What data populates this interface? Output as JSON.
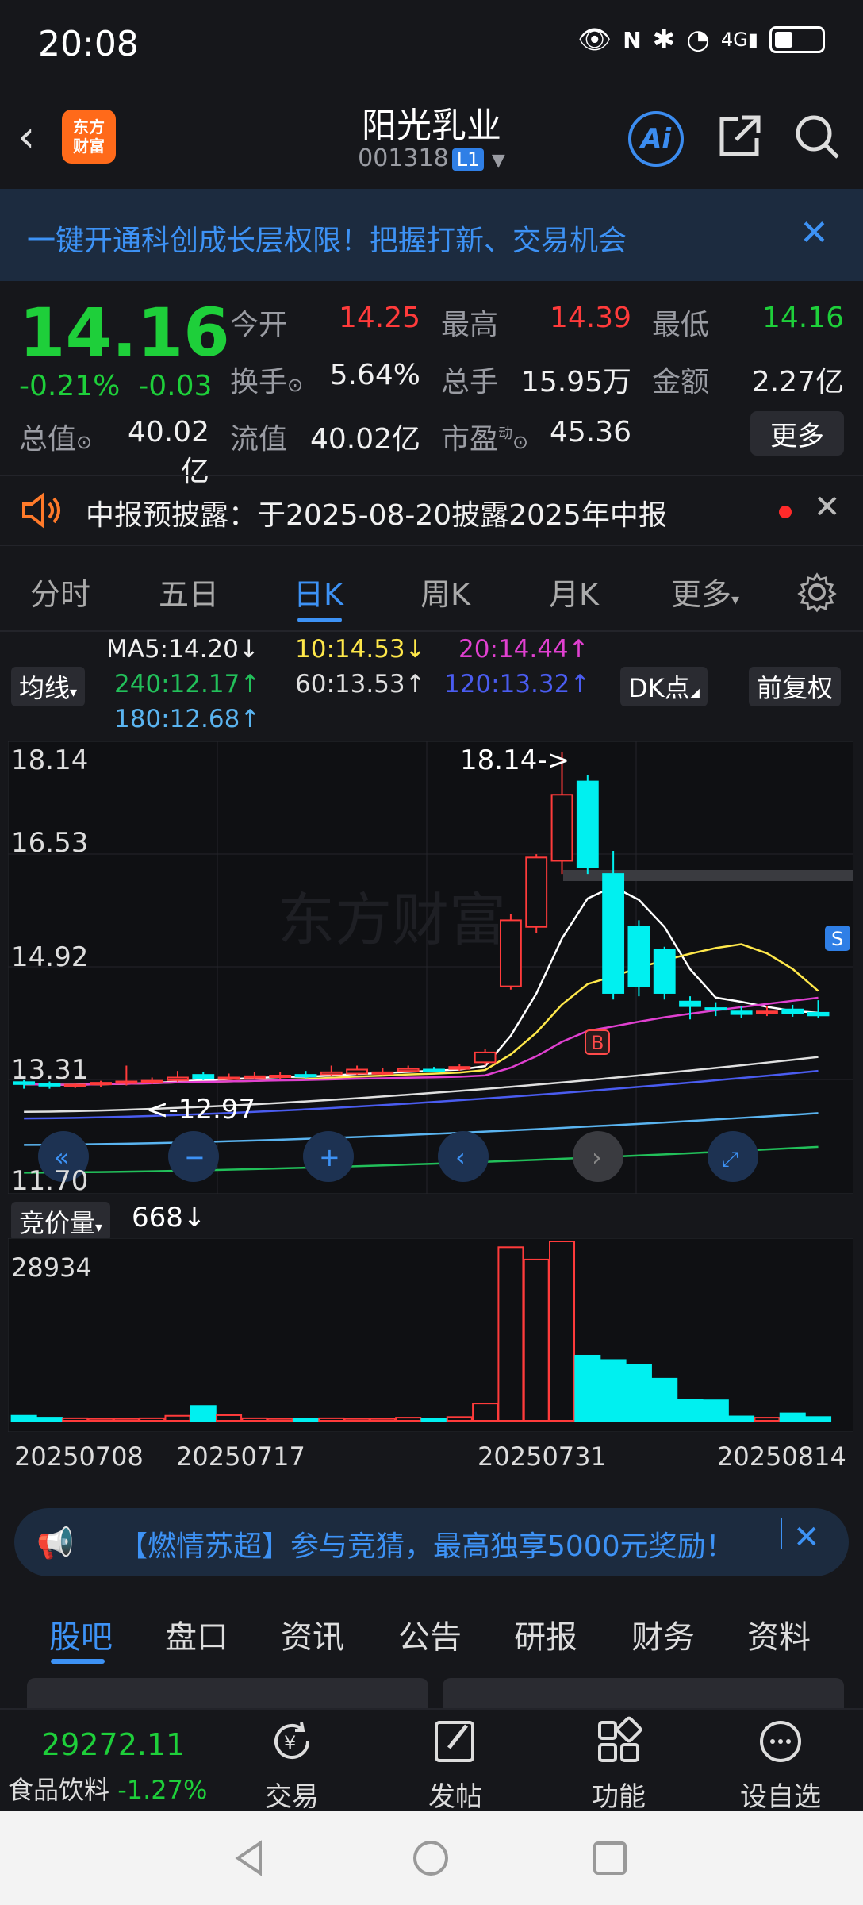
{
  "status": {
    "time": "20:08",
    "network": "4G"
  },
  "header": {
    "logo_line1": "东方",
    "logo_line2": "财富",
    "name": "阳光乳业",
    "code": "001318",
    "level": "L1"
  },
  "promo": {
    "text": "一键开通科创成长层权限！把握打新、交易机会"
  },
  "quote": {
    "price": "14.16",
    "change_pct": "-0.21%",
    "change_abs": "-0.03",
    "open_label": "今开",
    "open": "14.25",
    "high_label": "最高",
    "high": "14.39",
    "low_label": "最低",
    "low": "14.16",
    "turnover_label": "换手",
    "turnover": "5.64%",
    "volume_label": "总手",
    "volume": "15.95万",
    "amount_label": "金额",
    "amount": "2.27亿",
    "mktcap_label": "总值",
    "mktcap": "40.02亿",
    "float_label": "流值",
    "float": "40.02亿",
    "pe_label": "市盈",
    "pe_sup": "动",
    "pe": "45.36",
    "more": "更多"
  },
  "notice": {
    "text": "中报预披露：于2025-08-20披露2025年中报"
  },
  "period_tabs": [
    "分时",
    "五日",
    "日K",
    "周K",
    "月K",
    "更多"
  ],
  "ma_legend": {
    "ma5": "MA5:14.20↓",
    "ma10": "10:14.53↓",
    "ma20": "20:14.44↑",
    "ma240": "240:12.17↑",
    "ma60": "60:13.53↑",
    "ma120": "120:13.32↑",
    "ma180": "180:12.68↑",
    "indicator": "均线",
    "dk": "DK点",
    "adjust": "前复权"
  },
  "chart_labels": {
    "y_top": "18.14",
    "y2": "16.53",
    "y3": "14.92",
    "y4": "13.31",
    "y_bottom": "11.70",
    "high_mark": "18.14->",
    "low_mark": "<-12.97",
    "buy": "B",
    "sell": "S",
    "vol_label": "竞价量",
    "vol_value": "668↓",
    "vol_max": "28934"
  },
  "x_dates": [
    "20250708",
    "20250717",
    "20250731",
    "20250814"
  ],
  "chart_data": {
    "type": "candlestick",
    "open": [
      13.15,
      13.12,
      13.1,
      13.12,
      13.14,
      13.15,
      13.18,
      13.26,
      13.2,
      13.22,
      13.24,
      13.26,
      13.27,
      13.28,
      13.3,
      13.32,
      13.34,
      13.35,
      13.45,
      14.6,
      15.5,
      16.5,
      17.7,
      16.3,
      15.5,
      15.15,
      14.37,
      14.27,
      14.22,
      14.2,
      14.25,
      14.2
    ],
    "close": [
      13.12,
      13.1,
      13.11,
      13.14,
      13.16,
      13.17,
      13.22,
      13.21,
      13.22,
      13.24,
      13.25,
      13.24,
      13.3,
      13.34,
      13.3,
      13.35,
      13.33,
      13.38,
      13.6,
      15.6,
      16.55,
      17.5,
      16.4,
      14.5,
      14.6,
      14.5,
      14.3,
      14.25,
      14.18,
      14.22,
      14.19,
      14.16
    ],
    "high": [
      13.18,
      13.16,
      13.14,
      13.17,
      13.4,
      13.22,
      13.32,
      13.3,
      13.28,
      13.3,
      13.3,
      13.32,
      13.4,
      13.4,
      13.36,
      13.4,
      13.38,
      13.42,
      13.65,
      15.7,
      16.6,
      18.14,
      17.8,
      16.65,
      15.6,
      15.2,
      14.45,
      14.36,
      14.3,
      14.3,
      14.32,
      14.39
    ],
    "low": [
      13.05,
      13.05,
      13.06,
      13.08,
      13.1,
      13.12,
      13.15,
      13.18,
      13.18,
      13.2,
      13.2,
      13.21,
      13.24,
      13.26,
      13.26,
      13.3,
      13.3,
      13.32,
      13.4,
      14.55,
      15.4,
      16.3,
      16.3,
      14.4,
      14.45,
      14.4,
      14.1,
      14.15,
      14.12,
      14.15,
      14.14,
      14.12
    ],
    "volume": [
      800,
      500,
      400,
      300,
      300,
      400,
      800,
      2400,
      900,
      400,
      300,
      300,
      400,
      300,
      300,
      500,
      300,
      600,
      2800,
      28000,
      26000,
      28934,
      10500,
      9800,
      9000,
      6800,
      3400,
      3300,
      700,
      500,
      1200,
      600
    ],
    "y_range": [
      11.7,
      18.14
    ],
    "x_range": [
      "20250708",
      "20250814"
    ]
  },
  "contest": {
    "text": "【燃情苏超】参与竞猜，最高独享5000元奖励！"
  },
  "content_tabs": [
    "股吧",
    "盘口",
    "资讯",
    "公告",
    "研报",
    "财务",
    "资料"
  ],
  "bottom": {
    "index_value": "29272.11",
    "index_name": "食品饮料",
    "index_change": "-1.27%",
    "trade": "交易",
    "post": "发帖",
    "func": "功能",
    "watch": "设自选"
  }
}
